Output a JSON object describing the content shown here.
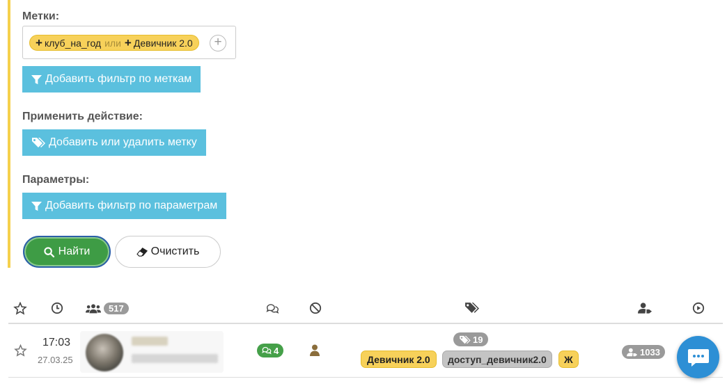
{
  "filters": {
    "tags_label": "Метки:",
    "tag_item_1": "клуб_на_год",
    "tag_or": "или",
    "tag_item_2": "Девичник 2.0",
    "add_tag_symbol": "+",
    "add_tag_filter_button": "Добавить фильтр по меткам",
    "action_label": "Применить действие:",
    "add_remove_tag_button": "Добавить или удалить метку",
    "params_label": "Параметры:",
    "add_param_filter_button": "Добавить фильтр по параметрам",
    "find_button": "Найти",
    "clear_button": "Очистить",
    "accent_color": "#f5d04c",
    "info_button_color": "#5bc0de",
    "find_button_color": "#3e9c45"
  },
  "table": {
    "header": {
      "users_count": "517",
      "icons": [
        "star-icon",
        "clock-icon",
        "users-icon",
        "comments-icon",
        "ban-icon",
        "tags-icon",
        "user-tag-icon",
        "play-icon"
      ]
    },
    "rows": [
      {
        "time": "17:03",
        "date": "27.03.25",
        "messages_count": "4",
        "tags_count": "19",
        "tags": [
          "Девичник 2.0",
          "доступ_девичник2.0",
          "Ж"
        ],
        "followers": "1033"
      }
    ]
  },
  "chat_button_icon": "chat-bubble-icon"
}
